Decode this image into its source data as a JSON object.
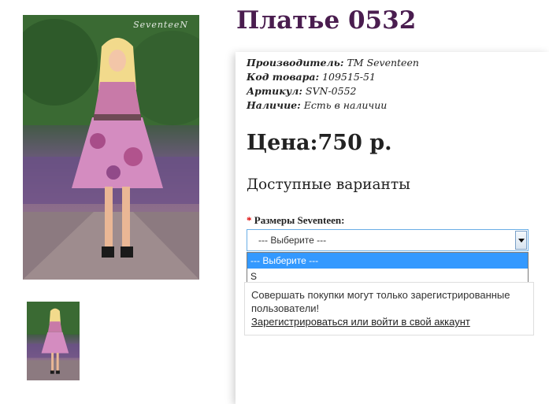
{
  "product": {
    "title": "Платье 0532",
    "watermark": "SeventeeN"
  },
  "meta": {
    "manufacturer_label": "Производитель:",
    "manufacturer_value": "TM Seventeen",
    "code_label": "Код товара:",
    "code_value": "109515-51",
    "article_label": "Артикул:",
    "article_value": "SVN-0552",
    "availability_label": "Наличие:",
    "availability_value": "Есть в наличии"
  },
  "price": "Цена:750 р.",
  "options": {
    "title": "Доступные варианты",
    "required_mark": "*",
    "size_label": "Размеры Seventeen:",
    "selected_value": "--- Выберите ---",
    "list": [
      "--- Выберите ---",
      "S"
    ]
  },
  "notice": {
    "text": "Совершать покупки могут только зарегистрированные пользователи!",
    "link": "Зарегистрироваться или войти в свой аккаунт"
  },
  "colors": {
    "title": "#4a1d4f",
    "required": "#dd0000",
    "dropdown_highlight": "#3399ff"
  }
}
